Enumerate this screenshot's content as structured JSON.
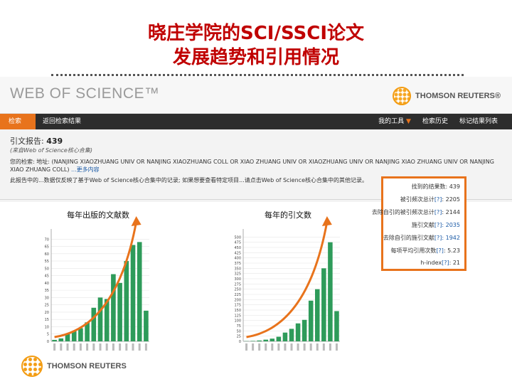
{
  "slide": {
    "title_line1": "晓庄学院的SCI/SSCI论文",
    "title_line2": "发展趋势和引用情况"
  },
  "header": {
    "logo_text": "WEB OF SCIENCE™",
    "brand_text": "THOMSON REUTERS®"
  },
  "nav": {
    "search_tab": "检索",
    "back_tab": "返回检索结果",
    "my_tools": "我的工具",
    "search_history": "检索历史",
    "marked_list": "标记结果列表"
  },
  "report": {
    "title_label": "引文报告: ",
    "title_count": "439",
    "from_db": "(来自Web of Science核心合集)",
    "query": "您的检索: 地址: (NANJING XIAOZHUANG UNIV OR NANJING XIAOZHUANG COLL OR XIAO ZHUANG UNIV OR XIAOZHUANG UNIV OR NANJING XIAO ZHUANG UNIV OR NANJING XIAO ZHUANG COLL)",
    "more_label": "...更多内容",
    "note": "此报告中的...数据仅反映了基于Web of Science核心合集中的记录; 如果想要查看特定项目...请点击Web of Science核心合集中的其他记录。"
  },
  "chart_data": [
    {
      "type": "bar",
      "title": "每年出版的文献数",
      "ylim": [
        0,
        75
      ],
      "yticks": [
        0,
        5,
        10,
        15,
        20,
        25,
        30,
        35,
        40,
        45,
        50,
        55,
        60,
        65,
        70
      ],
      "values": [
        1,
        2,
        5,
        7,
        9,
        13,
        23,
        30,
        29,
        46,
        40,
        55,
        66,
        68,
        21
      ]
    },
    {
      "type": "bar",
      "title": "每年的引文数",
      "ylim": [
        0,
        525
      ],
      "yticks": [
        0,
        25,
        50,
        75,
        100,
        125,
        150,
        175,
        200,
        225,
        250,
        275,
        300,
        325,
        350,
        375,
        400,
        425,
        450,
        475,
        500
      ],
      "values": [
        1,
        2,
        4,
        8,
        13,
        22,
        42,
        60,
        86,
        103,
        195,
        250,
        350,
        475,
        145
      ]
    }
  ],
  "summary": {
    "items": [
      {
        "label": "找到的结果数: ",
        "value": "439",
        "link": ""
      },
      {
        "label": "被引频次总计",
        "link": "[?]",
        "value": ": 2205"
      },
      {
        "label": "去除自引的被引频次总计",
        "link": "[?]",
        "value": ": 2144"
      },
      {
        "label": "施引文献",
        "link": "[?]",
        "value": ": 2035"
      },
      {
        "label": "去除自引的施引文献",
        "link": "[?]",
        "value": ": 1942"
      },
      {
        "label": "每项平均引用次数",
        "link": "[?]",
        "value": ": 5.23"
      },
      {
        "label": "h-index",
        "link": "[?]",
        "value": ": 21"
      }
    ]
  },
  "footer": {
    "brand_text": "THOMSON REUTERS"
  },
  "colors": {
    "title": "#c00000",
    "bar": "#2e9b5a",
    "arrow": "#e8731c",
    "nav_active": "#e8731c",
    "link": "#1a5aa6"
  }
}
